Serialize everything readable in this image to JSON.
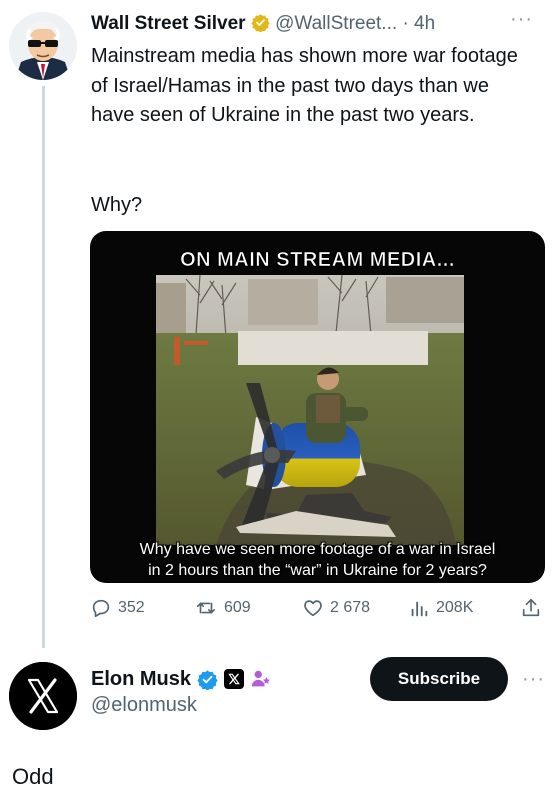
{
  "post": {
    "author_name": "Wall Street Silver",
    "author_handle": "@WallStreet...",
    "separator": "·",
    "time": "4h",
    "text": "Mainstream media has shown more war footage of Israel/Hamas in the past two days than we have seen of Ukraine in the past two years.",
    "text2": "Why?",
    "media": {
      "caption_top": "ON MAIN STREAM MEDIA...",
      "caption_bottom_line1": "Why have we seen more footage of a war in Israel",
      "caption_bottom_line2": "in 2 hours than the “war” in Ukraine for 2 years?"
    },
    "stats": {
      "replies": "352",
      "reposts": "609",
      "likes": "2 678",
      "views": "208K"
    }
  },
  "reply": {
    "author_name": "Elon Musk",
    "author_handle": "@elonmusk",
    "subscribe_label": "Subscribe",
    "text": "Odd"
  },
  "colors": {
    "verified_gold": "#e2b719",
    "verified_blue": "#1d9bf0",
    "muted": "#536471",
    "thread_line": "#cfd9de"
  }
}
